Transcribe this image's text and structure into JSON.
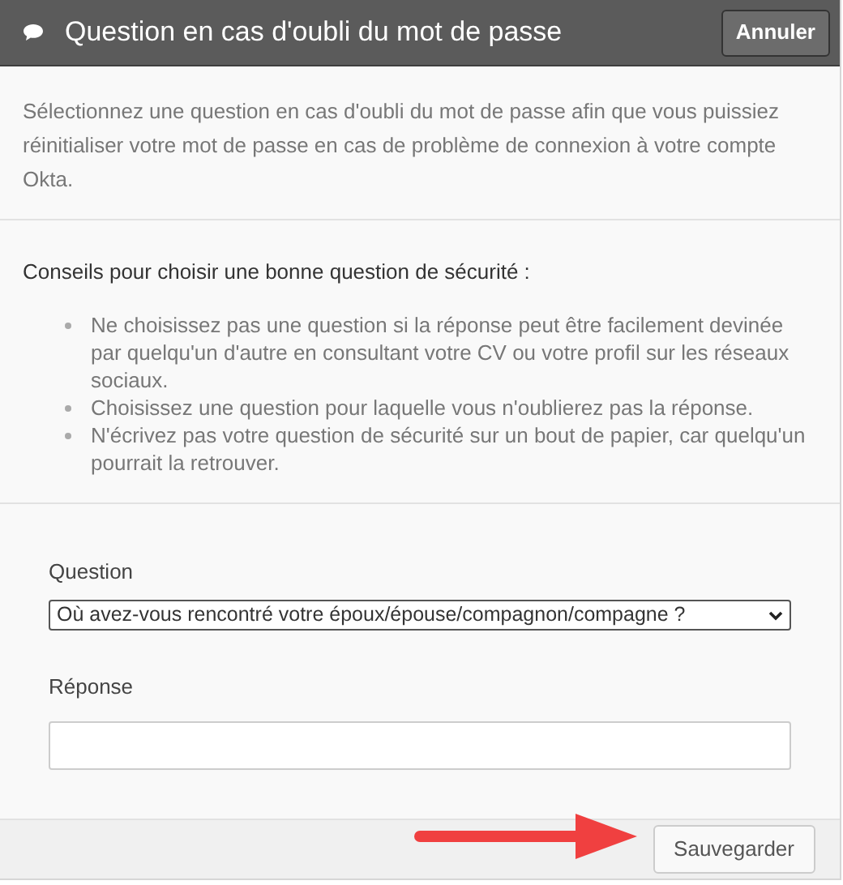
{
  "header": {
    "title": "Question en cas d'oubli du mot de passe",
    "cancel_button": "Annuler"
  },
  "intro": "Sélectionnez une question en cas d'oubli du mot de passe afin que vous puissiez réinitialiser votre mot de passe en cas de problème de connexion à votre compte Okta.",
  "tips": {
    "heading": "Conseils pour choisir une bonne question de sécurité :",
    "items": [
      "Ne choisissez pas une question si la réponse peut être facilement devinée par quelqu'un d'autre en consultant votre CV ou votre profil sur les réseaux sociaux.",
      "Choisissez une question pour laquelle vous n'oublierez pas la réponse.",
      "N'écrivez pas votre question de sécurité sur un bout de papier, car quelqu'un pourrait la retrouver."
    ]
  },
  "form": {
    "question_label": "Question",
    "question_value": "Où avez-vous rencontré votre époux/épouse/compagnon/compagne ?",
    "answer_label": "Réponse"
  },
  "footer": {
    "save_button": "Sauvegarder"
  }
}
